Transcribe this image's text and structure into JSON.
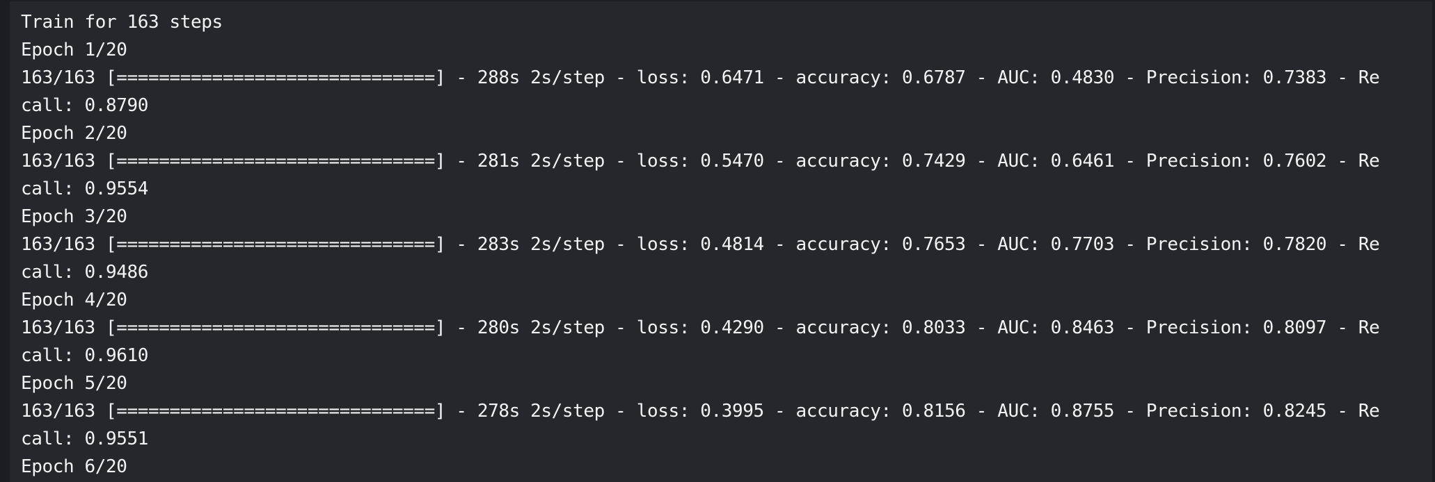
{
  "console": {
    "lines": [
      "Train for 163 steps",
      "Epoch 1/20",
      "163/163 [==============================] - 288s 2s/step - loss: 0.6471 - accuracy: 0.6787 - AUC: 0.4830 - Precision: 0.7383 - Re",
      "call: 0.8790",
      "Epoch 2/20",
      "163/163 [==============================] - 281s 2s/step - loss: 0.5470 - accuracy: 0.7429 - AUC: 0.6461 - Precision: 0.7602 - Re",
      "call: 0.9554",
      "Epoch 3/20",
      "163/163 [==============================] - 283s 2s/step - loss: 0.4814 - accuracy: 0.7653 - AUC: 0.7703 - Precision: 0.7820 - Re",
      "call: 0.9486",
      "Epoch 4/20",
      "163/163 [==============================] - 280s 2s/step - loss: 0.4290 - accuracy: 0.8033 - AUC: 0.8463 - Precision: 0.8097 - Re",
      "call: 0.9610",
      "Epoch 5/20",
      "163/163 [==============================] - 278s 2s/step - loss: 0.3995 - accuracy: 0.8156 - AUC: 0.8755 - Precision: 0.8245 - Re",
      "call: 0.9551",
      "Epoch 6/20"
    ]
  }
}
